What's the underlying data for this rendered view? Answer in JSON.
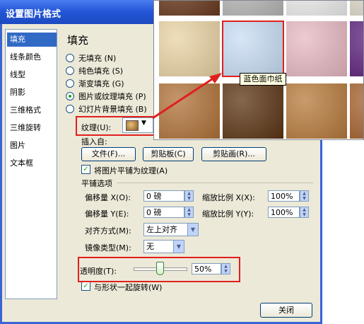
{
  "dialog": {
    "title": "设置图片格式"
  },
  "sidebar": {
    "items": [
      {
        "label": "填充",
        "selected": true
      },
      {
        "label": "线条颜色"
      },
      {
        "label": "线型"
      },
      {
        "label": "阴影"
      },
      {
        "label": "三维格式"
      },
      {
        "label": "三维旋转"
      },
      {
        "label": "图片"
      },
      {
        "label": "文本框"
      }
    ]
  },
  "fill": {
    "heading": "填充",
    "options": [
      {
        "label": "无填充 (N)"
      },
      {
        "label": "纯色填充 (S)"
      },
      {
        "label": "渐变填充 (G)"
      },
      {
        "label": "图片或纹理填充 (P)",
        "checked": true
      },
      {
        "label": "幻灯片背景填充 (B)"
      }
    ],
    "texture_label": "纹理(U):",
    "insert_from": "插入自:",
    "file_button": "文件(F)...",
    "clipboard_button": "剪贴板(C)",
    "clipart_button": "剪贴画(R)...",
    "tile_checkbox": "将图片平铺为纹理(A)",
    "tile_options": "平铺选项",
    "offset_x_label": "偏移量 X(O):",
    "offset_x_value": "0 磅",
    "scale_x_label": "缩放比例 X(X):",
    "scale_x_value": "100%",
    "offset_y_label": "偏移量 Y(E):",
    "offset_y_value": "0 磅",
    "scale_y_label": "缩放比例 Y(Y):",
    "scale_y_value": "100%",
    "alignment_label": "对齐方式(M):",
    "alignment_value": "左上对齐",
    "mirror_label": "镜像类型(M):",
    "mirror_value": "无",
    "transparency_label": "透明度(T):",
    "transparency_value": "50%",
    "transparency_level": 0.5,
    "rotate_checkbox": "与形状一起旋转(W)"
  },
  "close_button": "关闭",
  "texture_popup": {
    "tooltip": "蓝色面巾纸",
    "swatches": [
      {
        "name": "dark-wood-1",
        "color": "#6b3a1f"
      },
      {
        "name": "granite",
        "color": "#b8b8b8"
      },
      {
        "name": "white-marble",
        "color": "#efefef"
      },
      {
        "name": "light-stone",
        "color": "#e2dccd"
      },
      {
        "name": "parchment",
        "color": "#e9d3a3"
      },
      {
        "name": "blue-tissue-paper",
        "color": "#c9def5",
        "selected": true
      },
      {
        "name": "pink-tissue-paper",
        "color": "#e7b8c2"
      },
      {
        "name": "purple-mesh",
        "color": "#5a1f7a"
      },
      {
        "name": "cork",
        "color": "#b07238"
      },
      {
        "name": "walnut",
        "color": "#5b3413"
      },
      {
        "name": "oak",
        "color": "#b77a3b"
      },
      {
        "name": "medium-wood",
        "color": "#a55f2a"
      }
    ]
  },
  "colors": {
    "highlight": "#e0201e",
    "selection": "#316ac5",
    "title_bar": "#2255d5"
  }
}
